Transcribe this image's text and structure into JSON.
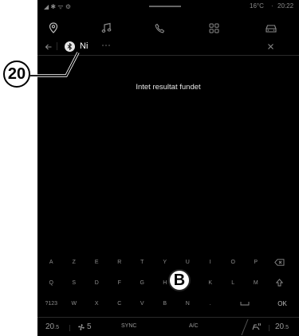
{
  "status": {
    "temperature": "16°C",
    "time": "20:22"
  },
  "nav": {
    "tabs": [
      {
        "name": "map-pin-icon"
      },
      {
        "name": "music-note-icon"
      },
      {
        "name": "phone-icon"
      },
      {
        "name": "apps-grid-icon"
      },
      {
        "name": "car-icon"
      }
    ]
  },
  "search": {
    "value": "Ni",
    "bluetooth_icon": "bluetooth-icon"
  },
  "result": {
    "message": "Intet resultat fundet"
  },
  "keyboard": {
    "row1": [
      "A",
      "Z",
      "E",
      "R",
      "T",
      "Y",
      "U",
      "I",
      "O",
      "P"
    ],
    "row2": [
      "Q",
      "S",
      "D",
      "F",
      "G",
      "H",
      "J",
      "K",
      "L",
      "M"
    ],
    "row3": [
      "?123",
      "W",
      "X",
      "C",
      "V",
      "B",
      "N",
      "."
    ],
    "ok": "OK"
  },
  "bottom_bar": {
    "left_temp": "20",
    "fan_level": "5",
    "sync": "SYNC",
    "ac": "A/C",
    "right_temp": "20"
  },
  "callouts": {
    "c20": "20",
    "b": "B"
  }
}
